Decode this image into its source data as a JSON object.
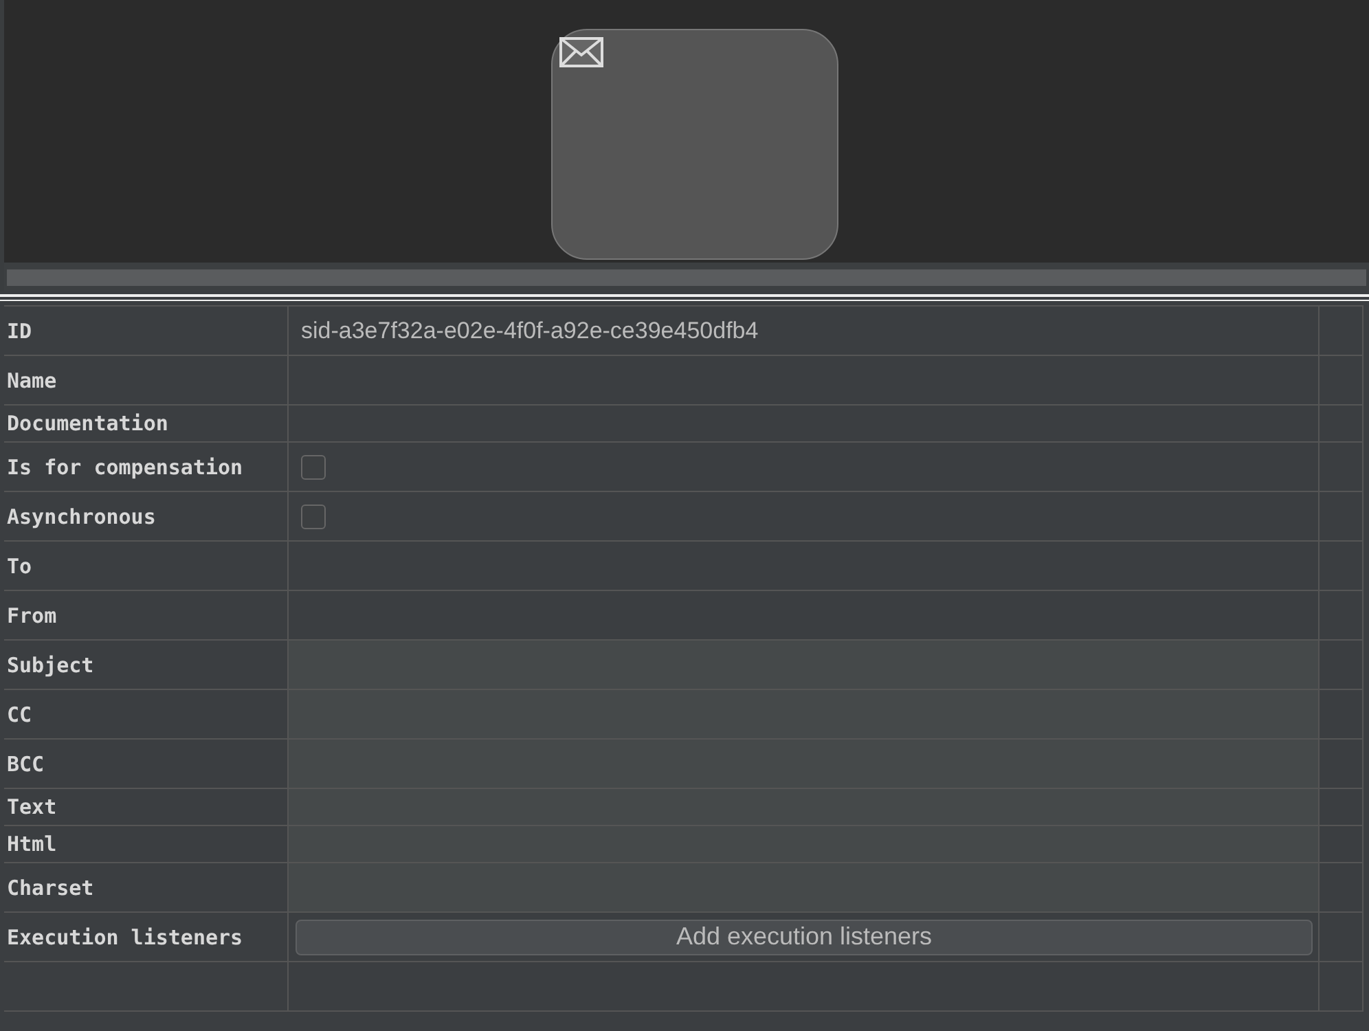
{
  "canvas": {
    "node": {
      "kind": "mail-task"
    }
  },
  "properties": [
    {
      "label": "ID",
      "kind": "text",
      "compact": false,
      "value": "sid-a3e7f32a-e02e-4f0f-a92e-ce39e450dfb4"
    },
    {
      "label": "Name",
      "kind": "text",
      "compact": false
    },
    {
      "label": "Documentation",
      "kind": "text",
      "compact": true
    },
    {
      "label": "Is for compensation",
      "kind": "checkbox",
      "compact": false,
      "checked": false
    },
    {
      "label": "Asynchronous",
      "kind": "checkbox",
      "compact": false,
      "checked": false
    },
    {
      "label": "To",
      "kind": "text",
      "compact": false
    },
    {
      "label": "From",
      "kind": "text",
      "compact": false
    },
    {
      "label": "Subject",
      "kind": "shaded",
      "compact": false
    },
    {
      "label": "CC",
      "kind": "shaded",
      "compact": false
    },
    {
      "label": "BCC",
      "kind": "shaded",
      "compact": false
    },
    {
      "label": "Text",
      "kind": "shaded",
      "compact": true
    },
    {
      "label": "Html",
      "kind": "shaded",
      "compact": true
    },
    {
      "label": "Charset",
      "kind": "shaded",
      "compact": false
    },
    {
      "label": "Execution listeners",
      "kind": "button",
      "compact": false,
      "button": "Add execution listeners"
    },
    {
      "kind": "empty",
      "compact": false
    }
  ]
}
